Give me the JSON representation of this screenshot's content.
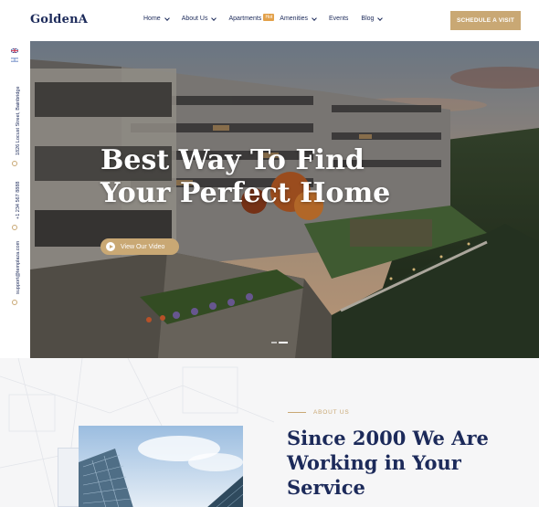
{
  "brand": {
    "logo": "GoldenA"
  },
  "nav": {
    "items": [
      {
        "label": "Home",
        "dropdown": true
      },
      {
        "label": "About Us",
        "dropdown": true
      },
      {
        "label": "Apartments",
        "dropdown": false,
        "badge": "Hot"
      },
      {
        "label": "Amenities",
        "dropdown": true
      },
      {
        "label": "Events",
        "dropdown": false
      },
      {
        "label": "Blog",
        "dropdown": true
      }
    ],
    "cta": "SCHEDULE A VISIT"
  },
  "sidebar": {
    "address": "1826 Locust Street, Bainbridge",
    "phone": "+1 234 567 8888",
    "email": "support@templaza.com",
    "flags": [
      "uk-flag",
      "il-flag"
    ]
  },
  "hero": {
    "title": "Best Way To Find Your Perfect Home",
    "video_label": "View Our Video",
    "slides": 2,
    "active_slide": 1
  },
  "about": {
    "eyebrow": "ABOUT US",
    "title": "Since 2000 We Are Working in Your Service"
  },
  "colors": {
    "primary": "#1c2a5a",
    "accent": "#c9a874",
    "badge": "#e3a14a"
  }
}
